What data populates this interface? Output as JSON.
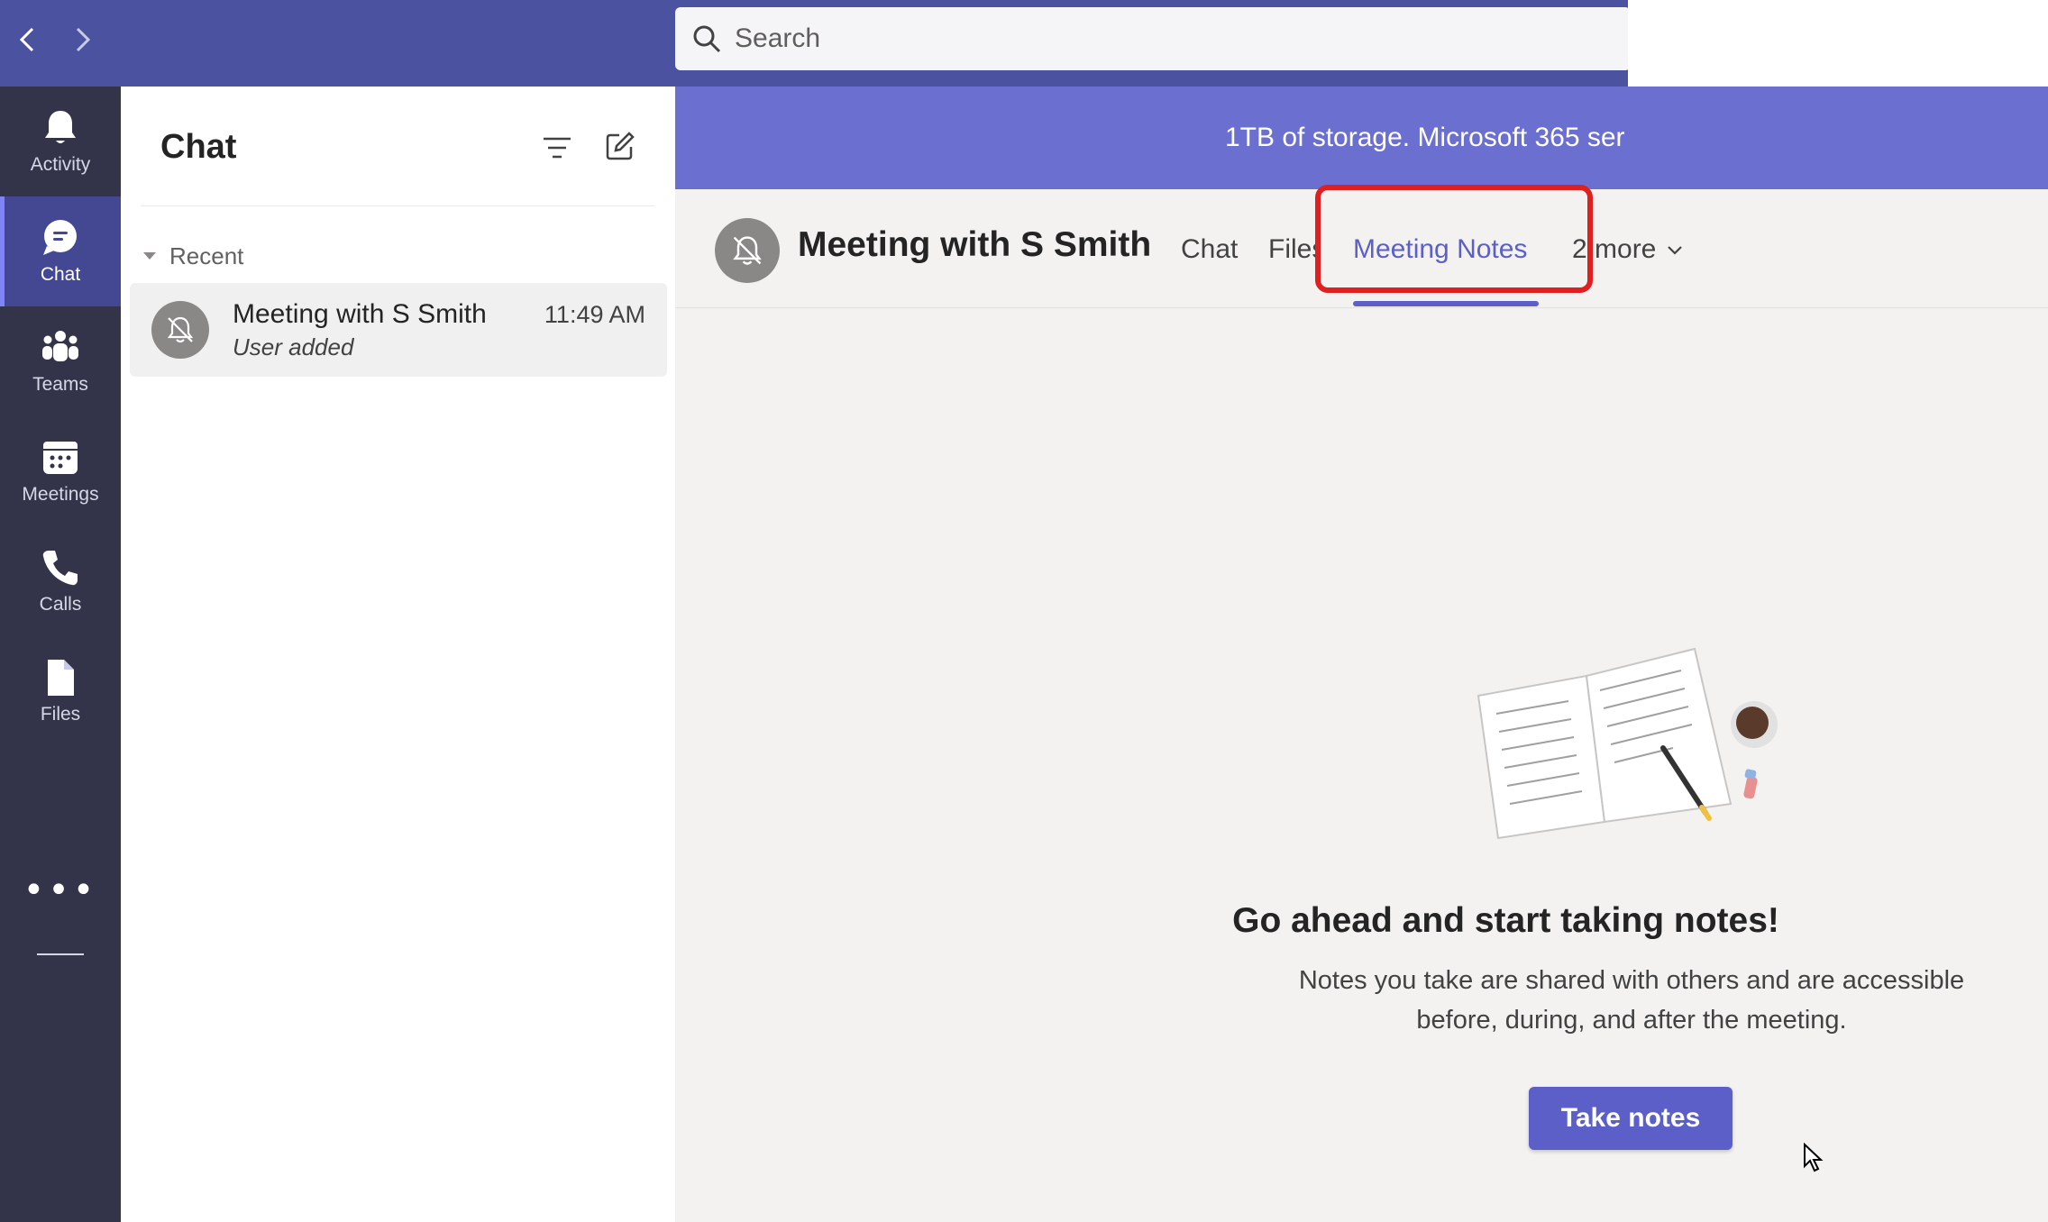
{
  "topbar": {
    "search_placeholder": "Search"
  },
  "rail": {
    "items": [
      {
        "label": "Activity",
        "icon": "bell-icon"
      },
      {
        "label": "Chat",
        "icon": "chat-icon",
        "active": true
      },
      {
        "label": "Teams",
        "icon": "teams-icon"
      },
      {
        "label": "Meetings",
        "icon": "calendar-icon"
      },
      {
        "label": "Calls",
        "icon": "phone-icon"
      },
      {
        "label": "Files",
        "icon": "file-icon"
      }
    ],
    "more": "•••"
  },
  "chatlist": {
    "title": "Chat",
    "section": "Recent",
    "items": [
      {
        "name": "Meeting with S Smith",
        "subtitle": "User added",
        "time": "11:49 AM"
      }
    ]
  },
  "banner": {
    "text": "1TB of storage. Microsoft 365 ser"
  },
  "header": {
    "title": "Meeting with S Smith",
    "tabs": [
      {
        "label": "Chat"
      },
      {
        "label": "Files"
      },
      {
        "label": "Meeting Notes",
        "active": true
      },
      {
        "label": "2 more"
      }
    ]
  },
  "empty_state": {
    "title": "Go ahead and start taking notes!",
    "line1": "Notes you take are shared with others and are accessible",
    "line2": "before, during, and after the meeting.",
    "button": "Take notes"
  },
  "colors": {
    "accent": "#5b5fc7",
    "rail_bg": "#33344a",
    "topbar_bg": "#4b53a0",
    "banner_bg": "#6b6fcf",
    "highlight": "#e02020"
  }
}
